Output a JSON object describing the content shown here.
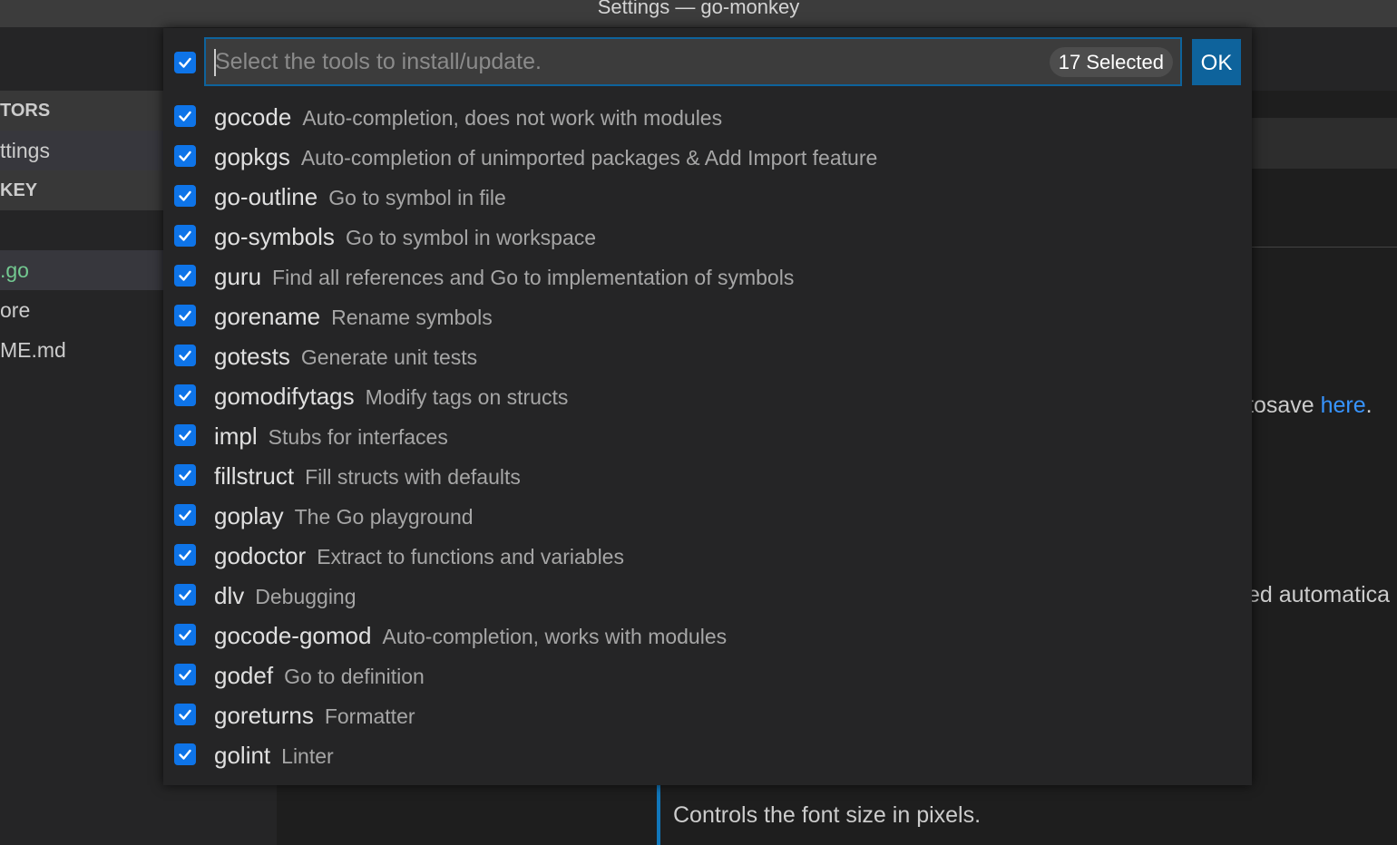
{
  "window": {
    "title": "Settings — go-monkey"
  },
  "sidebar": {
    "rows": [
      {
        "text": "",
        "kind": "plain"
      },
      {
        "text": "TORS",
        "kind": "header"
      },
      {
        "text": "ttings",
        "kind": "active"
      },
      {
        "text": "KEY",
        "kind": "header"
      },
      {
        "text": "",
        "kind": "plain"
      },
      {
        "text": ".go",
        "kind": "go"
      },
      {
        "text": "ore",
        "kind": "plain"
      },
      {
        "text": "ME.md",
        "kind": "plain"
      }
    ]
  },
  "editor": {
    "autosave_prefix": "tosave ",
    "autosave_link": "here",
    "autosave_suffix": ".",
    "automatica_text": "ed automatica",
    "font_size_description": "Controls the font size in pixels."
  },
  "quick_pick": {
    "placeholder": "Select the tools to install/update.",
    "selected_badge": "17 Selected",
    "ok_label": "OK",
    "select_all_checked": true,
    "accent_color": "#0e74e8",
    "items": [
      {
        "label": "gocode",
        "detail": "Auto-completion, does not work with modules",
        "checked": true
      },
      {
        "label": "gopkgs",
        "detail": "Auto-completion of unimported packages & Add Import feature",
        "checked": true
      },
      {
        "label": "go-outline",
        "detail": "Go to symbol in file",
        "checked": true
      },
      {
        "label": "go-symbols",
        "detail": "Go to symbol in workspace",
        "checked": true
      },
      {
        "label": "guru",
        "detail": "Find all references and Go to implementation of symbols",
        "checked": true
      },
      {
        "label": "gorename",
        "detail": "Rename symbols",
        "checked": true
      },
      {
        "label": "gotests",
        "detail": "Generate unit tests",
        "checked": true
      },
      {
        "label": "gomodifytags",
        "detail": "Modify tags on structs",
        "checked": true
      },
      {
        "label": "impl",
        "detail": "Stubs for interfaces",
        "checked": true
      },
      {
        "label": "fillstruct",
        "detail": "Fill structs with defaults",
        "checked": true
      },
      {
        "label": "goplay",
        "detail": "The Go playground",
        "checked": true
      },
      {
        "label": "godoctor",
        "detail": "Extract to functions and variables",
        "checked": true
      },
      {
        "label": "dlv",
        "detail": "Debugging",
        "checked": true
      },
      {
        "label": "gocode-gomod",
        "detail": "Auto-completion, works with modules",
        "checked": true
      },
      {
        "label": "godef",
        "detail": "Go to definition",
        "checked": true
      },
      {
        "label": "goreturns",
        "detail": "Formatter",
        "checked": true
      },
      {
        "label": "golint",
        "detail": "Linter",
        "checked": true
      }
    ]
  }
}
